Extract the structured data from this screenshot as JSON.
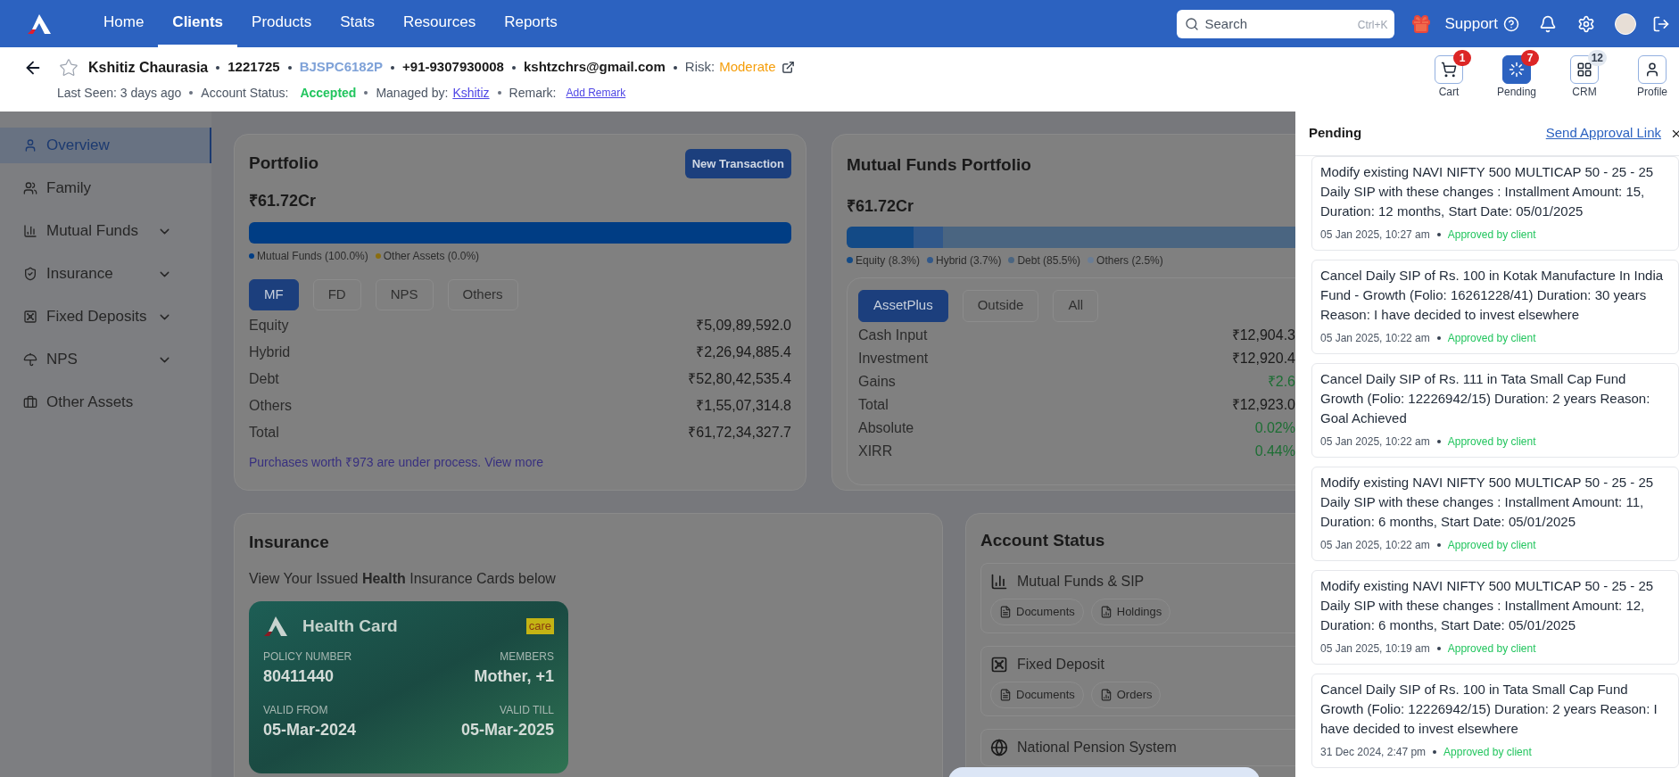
{
  "nav": {
    "items": [
      {
        "label": "Home",
        "selected": false
      },
      {
        "label": "Clients",
        "selected": true
      },
      {
        "label": "Products",
        "selected": false
      },
      {
        "label": "Stats",
        "selected": false
      },
      {
        "label": "Resources",
        "selected": false
      },
      {
        "label": "Reports",
        "selected": false
      }
    ],
    "search": {
      "placeholder": "Search",
      "shortcut": "Ctrl+K"
    },
    "support": "Support"
  },
  "client": {
    "name": "Kshitiz Chaurasia",
    "starred": false,
    "id": "1221725",
    "pan": "BJSPC6182P",
    "phone": "+91-9307930008",
    "email": "kshtzchrs@gmail.com",
    "risk_label": "Risk:",
    "risk": "Moderate",
    "last_seen": "Last Seen: 3 days ago",
    "status_label": "Account Status:",
    "status": "Accepted",
    "managed_label": "Managed by:",
    "manager": "Kshitiz",
    "remark_label": "Remark:",
    "remark_action": "Add Remark"
  },
  "quick_actions": [
    {
      "kind": "cart",
      "label": "Cart",
      "badge": "1",
      "color": "#dc2626",
      "selected": false
    },
    {
      "kind": "pending",
      "label": "Pending",
      "badge": "7",
      "color": "#dc2626",
      "selected": true
    },
    {
      "kind": "crm",
      "label": "CRM",
      "badge": "12",
      "color": "#e2e8f0",
      "selected": false
    },
    {
      "kind": "profile",
      "label": "Profile",
      "selected": false
    }
  ],
  "sidebar": {
    "items": [
      {
        "kind": "user",
        "label": "Overview",
        "selected": true,
        "has_submenu": false
      },
      {
        "kind": "users",
        "label": "Family",
        "selected": false,
        "has_submenu": false
      },
      {
        "kind": "chart",
        "label": "Mutual Funds",
        "selected": false,
        "has_submenu": true
      },
      {
        "kind": "shield",
        "label": "Insurance",
        "selected": false,
        "has_submenu": true
      },
      {
        "kind": "vault",
        "label": "Fixed Deposits",
        "selected": false,
        "has_submenu": true
      },
      {
        "kind": "umbrella",
        "label": "NPS",
        "selected": false,
        "has_submenu": true
      },
      {
        "kind": "briefcase",
        "label": "Other Assets",
        "selected": false,
        "has_submenu": false
      }
    ]
  },
  "portfolio": {
    "title": "Portfolio",
    "action": "New Transaction",
    "total": "₹61.72Cr",
    "segments": [
      {
        "label": "Mutual Funds (100.0%)",
        "color": "#003d84",
        "level": 1.0
      },
      {
        "label": "Other Assets (0.0%)",
        "color": "#8a6d10"
      }
    ],
    "tabs": [
      {
        "label": "MF",
        "selected": true
      },
      {
        "label": "FD",
        "selected": false
      },
      {
        "label": "NPS",
        "selected": false
      },
      {
        "label": "Others",
        "selected": false
      }
    ],
    "rows": [
      {
        "label": "Equity",
        "value": "₹5,09,89,592.0"
      },
      {
        "label": "Hybrid",
        "value": "₹2,26,94,885.4"
      },
      {
        "label": "Debt",
        "value": "₹52,80,42,535.4"
      },
      {
        "label": "Others",
        "value": "₹1,55,07,314.8"
      },
      {
        "label": "Total",
        "value": "₹61,72,34,327.7"
      }
    ],
    "note": "Purchases worth ₹973 are under process.",
    "note_link": "View more"
  },
  "mf_portfolio": {
    "title": "Mutual Funds Portfolio",
    "total": "₹61.72Cr",
    "segments": [
      {
        "label": "Equity (8.3%)",
        "color": "#134a86",
        "level": 0.083
      },
      {
        "label": "Hybrid (3.7%)",
        "color": "#31588a",
        "level": 0.037
      },
      {
        "label": "Debt (85.5%)",
        "color": "#4a6581"
      },
      {
        "label": "Others (2.5%)",
        "color": "#6a7d95"
      }
    ],
    "tabs": [
      {
        "label": "AssetPlus",
        "selected": true
      },
      {
        "label": "Outside",
        "selected": false
      },
      {
        "label": "All",
        "selected": false
      }
    ],
    "rows": [
      {
        "label": "Cash Input",
        "value": "₹12,904.3",
        "gain": false
      },
      {
        "label": "Investment",
        "value": "₹12,920.4",
        "gain": false
      },
      {
        "label": "Gains",
        "value": "₹2.6",
        "gain": true
      },
      {
        "label": "Total",
        "value": "₹12,923.0",
        "gain": false
      },
      {
        "label": "Absolute",
        "value": "0.02%",
        "gain": true
      },
      {
        "label": "XIRR",
        "value": "0.44%",
        "gain": true
      }
    ]
  },
  "insurance": {
    "title": "Insurance",
    "intro": "View Your Issued **Health** Insurance Cards below",
    "card": {
      "title": "Health Card",
      "insurer": "care",
      "policy_label": "POLICY NUMBER",
      "policy_number": "80411440",
      "members_label": "MEMBERS",
      "members": "Mother, +1",
      "valid_from_label": "VALID FROM",
      "valid_from": "05-Mar-2024",
      "valid_till_label": "VALID TILL",
      "valid_till": "05-Mar-2025"
    }
  },
  "account_status": {
    "title": "Account Status",
    "sections": [
      {
        "kind": "chart",
        "title": "Mutual Funds & SIP",
        "actions": [
          {
            "kind": "document",
            "label": "Documents"
          },
          {
            "kind": "report",
            "label": "Holdings"
          }
        ]
      },
      {
        "kind": "vault",
        "title": "Fixed Deposit",
        "actions": [
          {
            "kind": "document",
            "label": "Documents"
          },
          {
            "kind": "report",
            "label": "Orders"
          }
        ]
      },
      {
        "kind": "globe",
        "title": "National Pension System"
      }
    ]
  },
  "pending": {
    "title": "Pending",
    "action": "Send Approval Link",
    "items": [
      {
        "text": "Modify existing NAVI NIFTY 500 MULTICAP 50 - 25 - 25 Daily SIP with these changes : Installment Amount: 15, Duration: 12 months, Start Date: 05/01/2025",
        "time": "05 Jan 2025, 10:27 am",
        "status": "Approved by client"
      },
      {
        "text": "Cancel Daily SIP of Rs. 100 in Kotak Manufacture In India Fund - Growth (Folio: 16261228/41) Duration: 30 years Reason: I have decided to invest elsewhere",
        "time": "05 Jan 2025, 10:22 am",
        "status": "Approved by client"
      },
      {
        "text": "Cancel Daily SIP of Rs. 111 in Tata Small Cap Fund Growth (Folio: 12226942/15) Duration: 2 years Reason: Goal Achieved",
        "time": "05 Jan 2025, 10:22 am",
        "status": "Approved by client"
      },
      {
        "text": "Modify existing NAVI NIFTY 500 MULTICAP 50 - 25 - 25 Daily SIP with these changes : Installment Amount: 11, Duration: 6 months, Start Date: 05/01/2025",
        "time": "05 Jan 2025, 10:22 am",
        "status": "Approved by client"
      },
      {
        "text": "Modify existing NAVI NIFTY 500 MULTICAP 50 - 25 - 25 Daily SIP with these changes : Installment Amount: 12, Duration: 6 months, Start Date: 05/01/2025",
        "time": "05 Jan 2025, 10:19 am",
        "status": "Approved by client"
      },
      {
        "text": "Cancel Daily SIP of Rs. 100 in Tata Small Cap Fund Growth (Folio: 12226942/15) Duration: 2 years Reason: I have decided to invest elsewhere",
        "time": "31 Dec 2024, 2:47 pm",
        "status": "Approved by client"
      }
    ]
  }
}
